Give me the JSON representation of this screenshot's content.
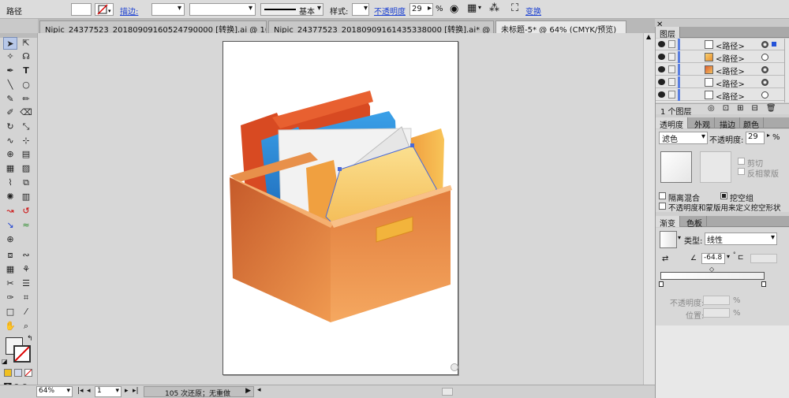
{
  "control_bar": {
    "selection_label": "路径",
    "stroke_link": "描边:",
    "stroke_profile_label": "基本",
    "style_label": "样式:",
    "opacity_link": "不透明度",
    "opacity_value": "29",
    "opacity_unit": "%",
    "transform_link": "变换"
  },
  "tabs": [
    {
      "label": "Nipic_24377523_20180909160524790000 [转换].ai @ 10..."
    },
    {
      "label": "Nipic_24377523_20180909161435338000 [转换].ai* @ 6..."
    },
    {
      "label": "未标题-5* @ 64% (CMYK/预览)"
    }
  ],
  "status_bar": {
    "zoom": "64%",
    "page": "1",
    "history_text": "105 次还原；无重做"
  },
  "layers_panel": {
    "title": "图层",
    "rows": [
      {
        "name": "<路径>",
        "target": "filled",
        "selected": true,
        "thumb": "white"
      },
      {
        "name": "<路径>",
        "target": "empty",
        "selected": false,
        "thumb": "folder"
      },
      {
        "name": "<路径>",
        "target": "filled",
        "selected": false,
        "thumb": "doc"
      },
      {
        "name": "<路径>",
        "target": "filled",
        "selected": false,
        "thumb": "white"
      },
      {
        "name": "<路径>",
        "target": "empty",
        "selected": false,
        "thumb": "white"
      }
    ],
    "footer_count": "1 个图层"
  },
  "transparency_panel": {
    "tabs": [
      "透明度",
      "外观",
      "描边",
      "颜色"
    ],
    "blend_mode": "滤色",
    "opacity_label": "不透明度:",
    "opacity_value": "29",
    "opacity_unit": "%",
    "clip_label": "剪切",
    "invert_mask_label": "反相蒙版",
    "isolate_blend_label": "隔离混合",
    "knockout_group_label": "挖空组",
    "define_knockout_label": "不透明度和蒙版用来定义挖空形状"
  },
  "gradient_panel": {
    "tabs": [
      "渐变",
      "色板"
    ],
    "type_label": "类型:",
    "type_value": "线性",
    "angle_value": "-64.8",
    "opacity_label": "不透明度:",
    "opacity_unit": "%",
    "location_label": "位置:",
    "location_unit": "%"
  },
  "colors": {
    "accent_blue": "#1a3fd1",
    "box_orange": "#e07a3a",
    "folder_blue": "#2f8fd6",
    "folder_red": "#d84a22",
    "label_yellow": "#f2b43c"
  }
}
